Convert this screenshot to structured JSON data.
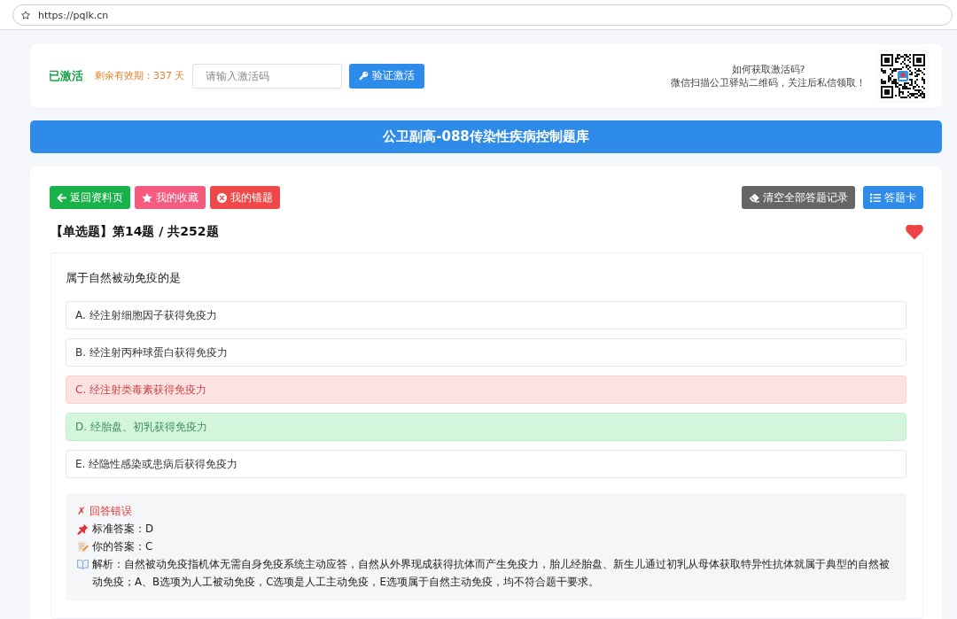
{
  "browser": {
    "url": "https://pqlk.cn"
  },
  "activation": {
    "status": "已激活",
    "remaining": "剩余有效期：337 天",
    "code_field": {
      "placeholder": "请输入激活码"
    },
    "verify_button": "验证激活",
    "help_lines": [
      "如何获取激活码?",
      "微信扫描公卫驿站二维码，关注后私信领取！"
    ]
  },
  "bank_title": "公卫副高-088传染性疾病控制题库",
  "toolbar": {
    "left_buttons": [
      {
        "kind": "back",
        "label": "返回资料页"
      },
      {
        "kind": "favorites",
        "label": "我的收藏"
      },
      {
        "kind": "mistakes",
        "label": "我的错题"
      }
    ],
    "right_buttons": [
      {
        "kind": "clear",
        "label": "清空全部答题记录"
      },
      {
        "kind": "answer_sheet",
        "label": "答题卡"
      }
    ]
  },
  "question": {
    "heading": "【单选题】第14题 / 共252题",
    "favorited": true,
    "text": "属于自然被动免疫的是",
    "options": [
      {
        "label": "A. 经注射细胞因子获得免疫力",
        "selected": false,
        "correct": false
      },
      {
        "label": "B. 经注射丙种球蛋白获得免疫力",
        "selected": false,
        "correct": false
      },
      {
        "label": "C. 经注射类毒素获得免疫力",
        "selected": true,
        "correct": false
      },
      {
        "label": "D. 经胎盘、初乳获得免疫力",
        "selected": false,
        "correct": true
      },
      {
        "label": "E. 经隐性感染或患病后获得免疫力",
        "selected": false,
        "correct": false
      }
    ],
    "result": {
      "correct": false,
      "verdict": "✗ 回答错误",
      "lines": [
        {
          "kind": "standard_answer",
          "text": "标准答案：D"
        },
        {
          "kind": "your_answer",
          "text": "你的答案：C"
        },
        {
          "kind": "analysis",
          "text": "解析：自然被动免疫指机体无需自身免疫系统主动应答，自然从外界现成获得抗体而产生免疫力，胎儿经胎盘、新生儿通过初乳从母体获取特异性抗体就属于典型的自然被动免疫；A、B选项为人工被动免疫，C选项是人工主动免疫，E选项属于自然主动免疫，均不符合题干要求。"
        }
      ]
    }
  }
}
